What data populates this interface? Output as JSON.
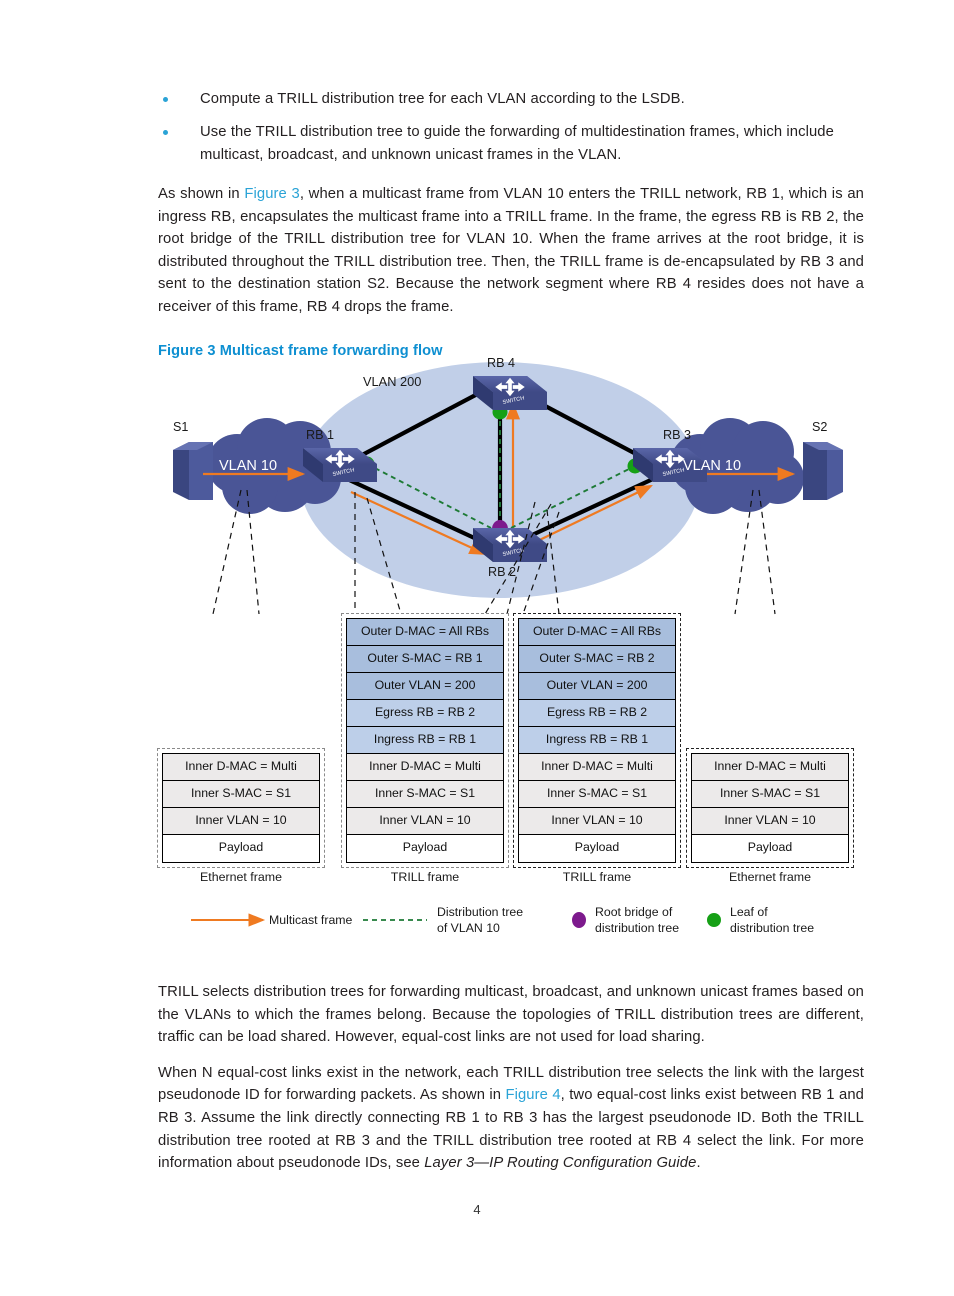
{
  "document": {
    "page_number": "4",
    "accent_blue": "#2aa3d6",
    "caption_blue": "#0d8fd1"
  },
  "bullets": [
    "Compute a TRILL distribution tree for each VLAN according to the LSDB.",
    "Use the TRILL distribution tree to guide the forwarding of multidestination frames, which include multicast, broadcast, and unknown unicast frames in the VLAN."
  ],
  "paragraphs": {
    "intro_pre": "As shown in ",
    "intro_xref": "Figure 3",
    "intro_post": ", when a multicast frame from VLAN 10 enters the TRILL network, RB 1, which is an ingress RB, encapsulates the multicast frame into a TRILL frame. In the frame, the egress RB is RB 2, the root bridge of the TRILL distribution tree for VLAN 10. When the frame arrives at the root bridge, it is distributed throughout the TRILL distribution tree. Then, the TRILL frame is de-encapsulated by RB 3 and sent to the destination station S2. Because the network segment where RB 4 resides does not have a receiver of this frame, RB 4 drops the frame.",
    "tail_1": "TRILL selects distribution trees for forwarding multicast, broadcast, and unknown unicast frames based on the VLANs to which the frames belong. Because the topologies of TRILL distribution trees are different, traffic can be load shared. However, equal-cost links are not used for load sharing.",
    "tail_2_pre": "When N equal-cost links exist in the network, each TRILL distribution tree selects the link with the largest pseudonode ID for forwarding packets. As shown in ",
    "tail_2_xref": "Figure 4",
    "tail_2_mid": ", two equal-cost links exist between RB 1 and RB 3. Assume the link directly connecting RB 1 to RB 3 has the largest pseudonode ID. Both the TRILL distribution tree rooted at RB 3 and the TRILL distribution tree rooted at RB 4 select the link. For more information about pseudonode IDs, see ",
    "tail_2_italic": "Layer 3—IP Routing Configuration Guide",
    "tail_2_end": "."
  },
  "figure": {
    "caption": "Figure 3 Multicast frame forwarding flow",
    "cloud_region_label": "VLAN 200",
    "stations": [
      {
        "name": "S1"
      },
      {
        "name": "S2"
      }
    ],
    "vlan_clouds": [
      {
        "label": "VLAN 10"
      },
      {
        "label": "VLAN 10"
      }
    ],
    "switches": [
      {
        "label": "RB 1"
      },
      {
        "label": "RB 2"
      },
      {
        "label": "RB 3"
      },
      {
        "label": "RB 4"
      }
    ],
    "frames": [
      {
        "caption": "Ethernet frame",
        "rows": [
          {
            "text": "Inner D-MAC = Multi",
            "style": "inner"
          },
          {
            "text": "Inner S-MAC = S1",
            "style": "inner"
          },
          {
            "text": "Inner VLAN = 10",
            "style": "inner"
          },
          {
            "text": "Payload",
            "style": "payload"
          }
        ]
      },
      {
        "caption": "TRILL frame",
        "rows": [
          {
            "text": "Outer D-MAC = All RBs",
            "style": "outer"
          },
          {
            "text": "Outer S-MAC = RB 1",
            "style": "outer"
          },
          {
            "text": "Outer VLAN = 200",
            "style": "outer"
          },
          {
            "text": "Egress RB = RB 2",
            "style": "mid"
          },
          {
            "text": "Ingress RB = RB 1",
            "style": "mid"
          },
          {
            "text": "Inner D-MAC = Multi",
            "style": "inner"
          },
          {
            "text": "Inner S-MAC = S1",
            "style": "inner"
          },
          {
            "text": "Inner VLAN = 10",
            "style": "inner"
          },
          {
            "text": "Payload",
            "style": "payload"
          }
        ]
      },
      {
        "caption": "TRILL frame",
        "rows": [
          {
            "text": "Outer D-MAC = All RBs",
            "style": "outer"
          },
          {
            "text": "Outer S-MAC = RB 2",
            "style": "outer"
          },
          {
            "text": "Outer VLAN = 200",
            "style": "outer"
          },
          {
            "text": "Egress RB = RB 2",
            "style": "mid"
          },
          {
            "text": "Ingress RB = RB 1",
            "style": "mid"
          },
          {
            "text": "Inner D-MAC = Multi",
            "style": "inner"
          },
          {
            "text": "Inner S-MAC = S1",
            "style": "inner"
          },
          {
            "text": "Inner VLAN = 10",
            "style": "inner"
          },
          {
            "text": "Payload",
            "style": "payload"
          }
        ]
      },
      {
        "caption": "Ethernet frame",
        "rows": [
          {
            "text": "Inner D-MAC = Multi",
            "style": "inner"
          },
          {
            "text": "Inner S-MAC = S1",
            "style": "inner"
          },
          {
            "text": "Inner VLAN = 10",
            "style": "inner"
          },
          {
            "text": "Payload",
            "style": "payload"
          }
        ]
      }
    ],
    "legend": [
      {
        "marker": "orange-arrow",
        "line1": "Multicast frame",
        "line2": ""
      },
      {
        "marker": "green-dashed-line",
        "line1": "Distribution tree",
        "line2": "of VLAN 10"
      },
      {
        "marker": "purple-dot",
        "line1": "Root bridge of",
        "line2": "distribution tree"
      },
      {
        "marker": "green-dot",
        "line1": "Leaf of",
        "line2": "distribution tree"
      }
    ],
    "colors": {
      "trill_region": "#c1cfe8",
      "cloud": "#4a5596",
      "switch_top": "#4a5596",
      "multicast_arrow": "#ef7a21",
      "distribution_tree": "#1d7a35",
      "root_bridge": "#7d1a8d",
      "leaf": "#16a016",
      "link": "#000000"
    }
  }
}
